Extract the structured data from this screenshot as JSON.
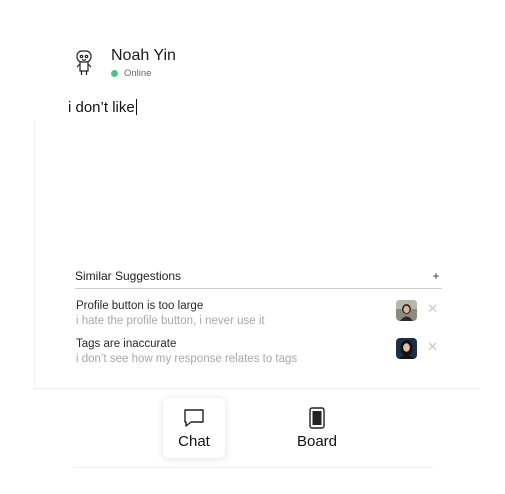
{
  "header": {
    "name": "Noah Yin",
    "status": "Online",
    "avatar_icon": "robot-avatar-icon",
    "status_color": "#4cc38a"
  },
  "composer": {
    "value": "i don’t like"
  },
  "suggestions": {
    "title": "Similar Suggestions",
    "add_label": "+",
    "items": [
      {
        "title": "Profile button is too large",
        "subtitle": "i hate the profile button, i never use it",
        "close_label": "✕"
      },
      {
        "title": "Tags are inaccurate",
        "subtitle": "i don’t see how my response relates to tags",
        "close_label": "✕"
      }
    ]
  },
  "tabbar": {
    "tabs": [
      {
        "label": "Chat",
        "icon": "chat-bubble-icon",
        "active": true
      },
      {
        "label": "Board",
        "icon": "board-icon",
        "active": false
      }
    ]
  }
}
